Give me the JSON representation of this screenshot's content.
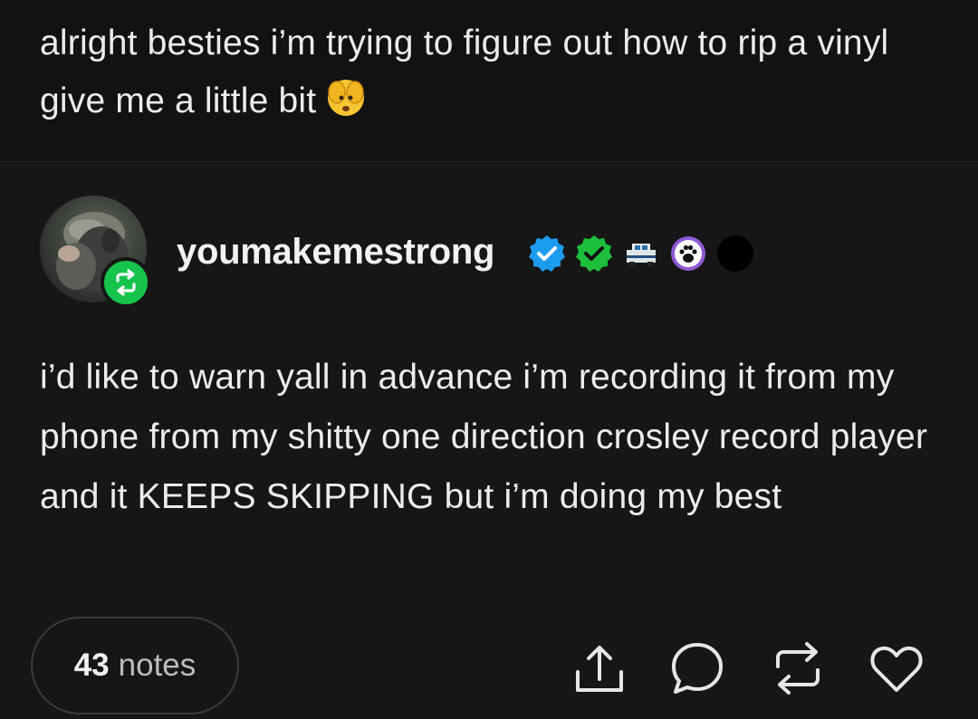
{
  "previous_post": {
    "text": "alright besties i’m trying to figure out how to rip a vinyl give me a little bit"
  },
  "reblog": {
    "username": "youmakemestrong",
    "badges": [
      "verified-blue-badge-icon",
      "verified-green-badge-icon",
      "pixel-car-badge-icon",
      "paw-badge-icon",
      "black-dot-badge-icon"
    ],
    "text": "i’d like to warn yall in advance i’m recording it from my phone from my shitty one direction crosley record player and it KEEPS SKIPPING but i’m doing my best"
  },
  "footer": {
    "notes_count": "43",
    "notes_label": "notes",
    "actions": [
      "share-icon",
      "reply-icon",
      "reblog-icon",
      "like-icon"
    ]
  },
  "colors": {
    "background": "#161616",
    "reblog_green": "#16c34b",
    "verified_blue": "#1d9bf0",
    "verified_green": "#1dbf3a",
    "paw_purple": "#8e5ad6"
  }
}
